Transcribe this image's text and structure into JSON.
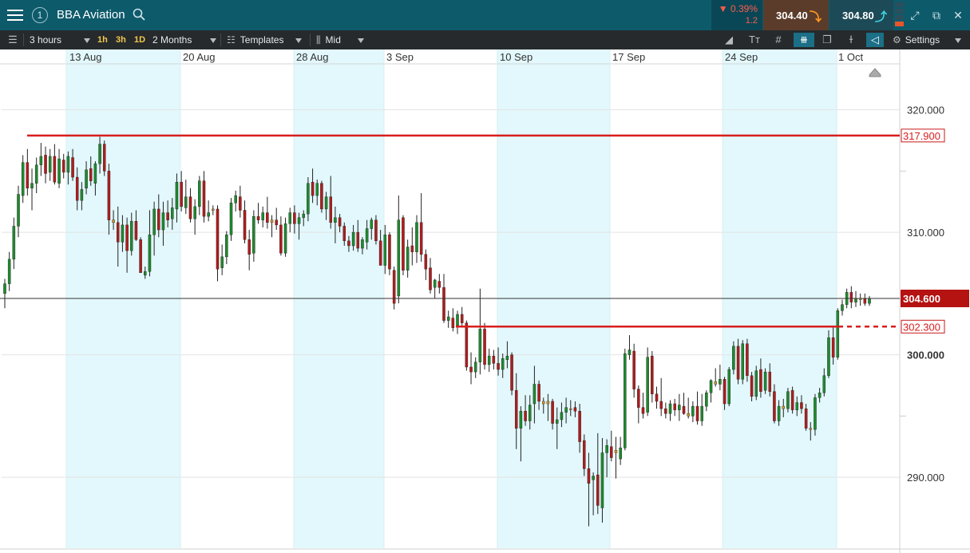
{
  "window": {
    "instrument_number": "1",
    "title": "BBA Aviation",
    "change_pct": "▼ 0.39%",
    "change_abs": "1.2",
    "sell_price": "304.40",
    "buy_price": "304.80"
  },
  "toolbar": {
    "interval": "3 hours",
    "quick_1h": "1h",
    "quick_3h": "3h",
    "quick_1d": "1D",
    "range": "2 Months",
    "templates": "Templates",
    "price_type": "Mid",
    "settings": "Settings"
  },
  "colors": {
    "up": "#1e8a2e",
    "down": "#b01c1c",
    "doji": "#d99a2b",
    "line": "#d81e1e",
    "weekend": "#e2f8fc"
  },
  "chart_data": {
    "type": "candlestick",
    "title": "BBA Aviation",
    "ylim": [
      284.5,
      321
    ],
    "y_ticks": [
      "290.000",
      "300.000",
      "310.000",
      "320.000"
    ],
    "x_ticks": [
      "13 Aug",
      "20 Aug",
      "28 Aug",
      "3 Sep",
      "10 Sep",
      "17 Sep",
      "24 Sep",
      "1 Oct"
    ],
    "current_price": "304.600",
    "lines": [
      {
        "label": "317.900",
        "value": 317.9,
        "style": "solid"
      },
      {
        "label": "302.300",
        "value": 302.3,
        "style": "solid-then-dashed"
      }
    ],
    "candles": [
      [
        305.0,
        306.2,
        303.8,
        305.8
      ],
      [
        305.8,
        308.4,
        305.2,
        307.8
      ],
      [
        307.8,
        311.2,
        307.0,
        310.5
      ],
      [
        310.5,
        313.8,
        309.6,
        313.1
      ],
      [
        313.0,
        316.3,
        312.4,
        315.7
      ],
      [
        315.7,
        316.8,
        313.0,
        313.6
      ],
      [
        313.6,
        315.2,
        311.8,
        314.0
      ],
      [
        314.0,
        316.1,
        313.2,
        315.5
      ],
      [
        315.5,
        317.3,
        314.6,
        316.2
      ],
      [
        316.3,
        317.0,
        314.0,
        314.8
      ],
      [
        314.9,
        316.8,
        314.2,
        316.2
      ],
      [
        316.2,
        317.2,
        313.9,
        314.1
      ],
      [
        314.0,
        316.8,
        313.6,
        316.0
      ],
      [
        315.9,
        316.4,
        314.4,
        314.9
      ],
      [
        314.9,
        316.6,
        313.9,
        316.2
      ],
      [
        316.1,
        316.8,
        314.2,
        314.5
      ],
      [
        314.5,
        315.3,
        311.8,
        312.6
      ],
      [
        312.6,
        314.1,
        311.8,
        313.5
      ],
      [
        313.6,
        315.8,
        313.1,
        315.1
      ],
      [
        315.2,
        316.2,
        313.8,
        314.2
      ],
      [
        314.0,
        315.8,
        313.0,
        315.6
      ],
      [
        315.6,
        317.8,
        314.8,
        317.2
      ],
      [
        317.2,
        317.5,
        314.6,
        315.0
      ],
      [
        315.0,
        315.6,
        309.8,
        311.0
      ],
      [
        311.0,
        311.8,
        310.2,
        310.8
      ],
      [
        310.8,
        312.1,
        307.2,
        309.2
      ],
      [
        309.2,
        311.4,
        308.4,
        310.6
      ],
      [
        310.6,
        311.2,
        306.7,
        308.5
      ],
      [
        308.5,
        311.6,
        308.1,
        310.9
      ],
      [
        310.9,
        311.8,
        309.3,
        309.4
      ],
      [
        309.4,
        309.6,
        306.7,
        306.7
      ],
      [
        306.5,
        307.2,
        306.2,
        306.8
      ],
      [
        306.8,
        311.8,
        306.4,
        309.8
      ],
      [
        309.8,
        312.5,
        308.1,
        311.9
      ],
      [
        311.9,
        313.1,
        309.6,
        310.2
      ],
      [
        310.2,
        312.5,
        308.9,
        311.6
      ],
      [
        311.6,
        312.6,
        310.4,
        311.0
      ],
      [
        311.1,
        312.8,
        310.2,
        312.0
      ],
      [
        311.9,
        314.8,
        310.8,
        314.1
      ],
      [
        314.1,
        315.0,
        311.7,
        312.1
      ],
      [
        312.0,
        314.3,
        311.5,
        312.9
      ],
      [
        312.9,
        313.6,
        310.8,
        311.1
      ],
      [
        311.1,
        312.7,
        309.8,
        312.1
      ],
      [
        312.1,
        314.6,
        311.4,
        314.2
      ],
      [
        314.2,
        315.0,
        310.8,
        311.3
      ],
      [
        311.3,
        312.6,
        310.9,
        311.6
      ],
      [
        311.8,
        312.2,
        311.4,
        311.9
      ],
      [
        311.9,
        312.2,
        306.0,
        307.0
      ],
      [
        307.1,
        309.0,
        306.5,
        308.0
      ],
      [
        308.0,
        310.1,
        307.4,
        309.8
      ],
      [
        309.8,
        312.8,
        309.3,
        312.4
      ],
      [
        312.4,
        313.4,
        311.7,
        313.0
      ],
      [
        312.9,
        313.8,
        311.2,
        311.8
      ],
      [
        311.8,
        312.6,
        309.1,
        309.4
      ],
      [
        309.4,
        310.2,
        306.9,
        308.2
      ],
      [
        308.3,
        311.8,
        307.6,
        311.3
      ],
      [
        311.3,
        312.4,
        310.7,
        311.0
      ],
      [
        311.0,
        312.1,
        310.4,
        311.6
      ],
      [
        311.6,
        312.9,
        310.3,
        310.8
      ],
      [
        310.8,
        311.4,
        309.6,
        311.0
      ],
      [
        311.0,
        312.0,
        310.2,
        310.6
      ],
      [
        310.6,
        311.3,
        308.1,
        308.3
      ],
      [
        308.3,
        311.2,
        308.0,
        310.7
      ],
      [
        310.7,
        312.0,
        310.0,
        311.6
      ],
      [
        311.6,
        312.2,
        309.9,
        310.7
      ],
      [
        310.7,
        311.6,
        309.4,
        311.2
      ],
      [
        311.2,
        311.8,
        310.5,
        311.5
      ],
      [
        311.5,
        314.5,
        310.9,
        314.0
      ],
      [
        314.1,
        315.2,
        312.4,
        313.0
      ],
      [
        313.0,
        314.3,
        312.2,
        314.0
      ],
      [
        314.0,
        314.2,
        311.6,
        311.9
      ],
      [
        311.9,
        313.3,
        311.0,
        312.9
      ],
      [
        312.9,
        314.6,
        310.3,
        310.8
      ],
      [
        310.8,
        312.1,
        309.1,
        311.2
      ],
      [
        311.2,
        311.5,
        310.0,
        310.5
      ],
      [
        310.5,
        310.8,
        308.9,
        309.3
      ],
      [
        309.3,
        309.7,
        308.4,
        308.9
      ],
      [
        308.9,
        310.6,
        308.5,
        310.0
      ],
      [
        310.0,
        311.0,
        308.4,
        308.7
      ],
      [
        308.7,
        309.6,
        308.2,
        309.4
      ],
      [
        309.2,
        311.0,
        308.6,
        310.3
      ],
      [
        310.3,
        311.2,
        309.4,
        311.0
      ],
      [
        311.0,
        311.4,
        309.0,
        309.3
      ],
      [
        309.3,
        310.2,
        307.3,
        307.3
      ],
      [
        307.3,
        310.6,
        306.6,
        309.8
      ],
      [
        309.8,
        310.0,
        306.5,
        307.0
      ],
      [
        306.9,
        307.2,
        303.7,
        304.2
      ],
      [
        304.8,
        313.0,
        304.2,
        311.0
      ],
      [
        311.2,
        311.4,
        306.5,
        306.9
      ],
      [
        306.9,
        309.4,
        306.3,
        308.8
      ],
      [
        308.9,
        310.4,
        307.3,
        308.4
      ],
      [
        308.4,
        311.4,
        307.5,
        310.8
      ],
      [
        310.8,
        313.2,
        307.6,
        308.2
      ],
      [
        308.2,
        308.6,
        306.1,
        307.0
      ],
      [
        307.1,
        307.9,
        305.0,
        305.3
      ],
      [
        305.5,
        306.2,
        304.6,
        306.1
      ],
      [
        306.0,
        306.6,
        305.0,
        305.5
      ],
      [
        305.5,
        306.6,
        302.6,
        302.8
      ],
      [
        302.8,
        303.6,
        302.2,
        303.1
      ],
      [
        303.0,
        303.8,
        301.9,
        302.2
      ],
      [
        302.4,
        303.6,
        301.7,
        303.3
      ],
      [
        303.3,
        303.9,
        302.3,
        302.6
      ],
      [
        302.6,
        302.8,
        298.7,
        299.0
      ],
      [
        299.0,
        300.2,
        297.6,
        298.6
      ],
      [
        298.6,
        299.8,
        298.1,
        299.4
      ],
      [
        299.4,
        305.4,
        298.4,
        302.1
      ],
      [
        302.1,
        302.6,
        298.8,
        299.2
      ],
      [
        299.2,
        300.5,
        298.6,
        299.9
      ],
      [
        299.9,
        300.4,
        298.8,
        299.3
      ],
      [
        299.3,
        300.6,
        298.3,
        298.8
      ],
      [
        298.8,
        300.1,
        298.1,
        299.7
      ],
      [
        299.6,
        301.1,
        298.9,
        299.9
      ],
      [
        300.0,
        300.2,
        296.7,
        297.1
      ],
      [
        297.1,
        298.5,
        292.3,
        294.0
      ],
      [
        294.0,
        295.8,
        291.3,
        295.4
      ],
      [
        295.4,
        296.7,
        294.2,
        294.6
      ],
      [
        294.6,
        296.7,
        293.9,
        295.9
      ],
      [
        296.0,
        299.1,
        294.4,
        297.6
      ],
      [
        297.6,
        297.9,
        295.5,
        296.2
      ],
      [
        296.2,
        296.5,
        295.2,
        296.0
      ],
      [
        296.0,
        296.8,
        294.6,
        296.2
      ],
      [
        296.2,
        296.4,
        293.9,
        294.4
      ],
      [
        294.4,
        295.7,
        292.3,
        294.7
      ],
      [
        294.7,
        296.1,
        294.1,
        295.3
      ],
      [
        295.3,
        296.5,
        294.4,
        295.7
      ],
      [
        295.6,
        296.3,
        295.0,
        295.6
      ],
      [
        295.7,
        296.2,
        294.9,
        295.4
      ],
      [
        295.4,
        296.0,
        292.0,
        292.9
      ],
      [
        293.0,
        293.5,
        290.1,
        290.7
      ],
      [
        290.7,
        292.0,
        286.0,
        289.5
      ],
      [
        289.8,
        290.4,
        286.9,
        290.1
      ],
      [
        290.2,
        293.6,
        287.0,
        287.7
      ],
      [
        287.5,
        293.2,
        286.3,
        292.0
      ],
      [
        292.0,
        293.1,
        290.0,
        292.6
      ],
      [
        292.5,
        293.8,
        291.3,
        291.6
      ],
      [
        292.2,
        293.3,
        289.9,
        292.0
      ],
      [
        291.5,
        293.3,
        291.0,
        292.4
      ],
      [
        292.4,
        300.5,
        292.2,
        300.1
      ],
      [
        300.0,
        301.6,
        299.6,
        300.4
      ],
      [
        300.3,
        300.9,
        296.5,
        297.2
      ],
      [
        297.2,
        297.5,
        294.4,
        295.7
      ],
      [
        295.7,
        296.9,
        294.8,
        295.2
      ],
      [
        295.3,
        300.6,
        295.0,
        299.8
      ],
      [
        299.9,
        300.3,
        296.1,
        296.8
      ],
      [
        296.8,
        297.4,
        295.6,
        296.2
      ],
      [
        296.2,
        298.1,
        295.0,
        295.6
      ],
      [
        295.6,
        296.1,
        294.8,
        295.2
      ],
      [
        295.2,
        296.3,
        294.6,
        296.0
      ],
      [
        296.0,
        296.4,
        295.0,
        295.5
      ],
      [
        295.5,
        296.8,
        294.6,
        295.9
      ],
      [
        295.8,
        296.9,
        295.1,
        295.2
      ],
      [
        295.2,
        296.5,
        294.8,
        295.0
      ],
      [
        295.0,
        296.2,
        294.5,
        295.8
      ],
      [
        295.8,
        297.0,
        294.3,
        294.6
      ],
      [
        294.6,
        296.8,
        294.2,
        295.8
      ],
      [
        295.8,
        297.1,
        295.4,
        296.9
      ],
      [
        296.9,
        298.0,
        296.1,
        297.9
      ],
      [
        297.8,
        298.9,
        297.4,
        297.6
      ],
      [
        297.6,
        299.2,
        297.1,
        298.0
      ],
      [
        298.0,
        298.2,
        295.5,
        296.0
      ],
      [
        296.0,
        299.0,
        295.8,
        298.8
      ],
      [
        298.8,
        301.1,
        298.4,
        300.7
      ],
      [
        300.7,
        301.3,
        297.6,
        298.0
      ],
      [
        298.0,
        301.2,
        297.6,
        300.9
      ],
      [
        300.9,
        301.3,
        297.8,
        298.3
      ],
      [
        298.3,
        298.6,
        296.2,
        296.6
      ],
      [
        296.6,
        299.1,
        296.3,
        298.7
      ],
      [
        298.8,
        299.7,
        296.5,
        297.0
      ],
      [
        297.1,
        298.9,
        296.8,
        298.6
      ],
      [
        298.6,
        299.3,
        296.6,
        297.0
      ],
      [
        297.0,
        297.6,
        294.4,
        294.6
      ],
      [
        294.6,
        296.3,
        294.2,
        295.8
      ],
      [
        295.8,
        296.4,
        294.9,
        295.6
      ],
      [
        295.6,
        297.3,
        295.3,
        297.0
      ],
      [
        297.1,
        297.4,
        295.2,
        295.5
      ],
      [
        295.5,
        296.6,
        295.0,
        296.1
      ],
      [
        296.1,
        296.7,
        295.2,
        295.6
      ],
      [
        295.6,
        296.0,
        293.8,
        294.0
      ],
      [
        294.0,
        294.5,
        293.0,
        293.9
      ],
      [
        293.9,
        296.8,
        293.4,
        296.5
      ],
      [
        296.5,
        297.3,
        296.1,
        296.9
      ],
      [
        296.9,
        298.9,
        296.6,
        298.3
      ],
      [
        298.3,
        302.0,
        298.1,
        301.4
      ],
      [
        301.4,
        302.3,
        299.2,
        299.8
      ],
      [
        299.8,
        303.8,
        299.6,
        303.6
      ],
      [
        303.6,
        304.5,
        303.2,
        304.1
      ],
      [
        304.1,
        305.4,
        303.8,
        305.1
      ],
      [
        305.1,
        305.6,
        303.8,
        304.3
      ],
      [
        304.3,
        305.2,
        303.9,
        304.6
      ],
      [
        304.6,
        305.0,
        304.0,
        304.5
      ],
      [
        304.6,
        305.0,
        304.0,
        304.2
      ],
      [
        304.2,
        304.8,
        304.0,
        304.6
      ]
    ]
  }
}
